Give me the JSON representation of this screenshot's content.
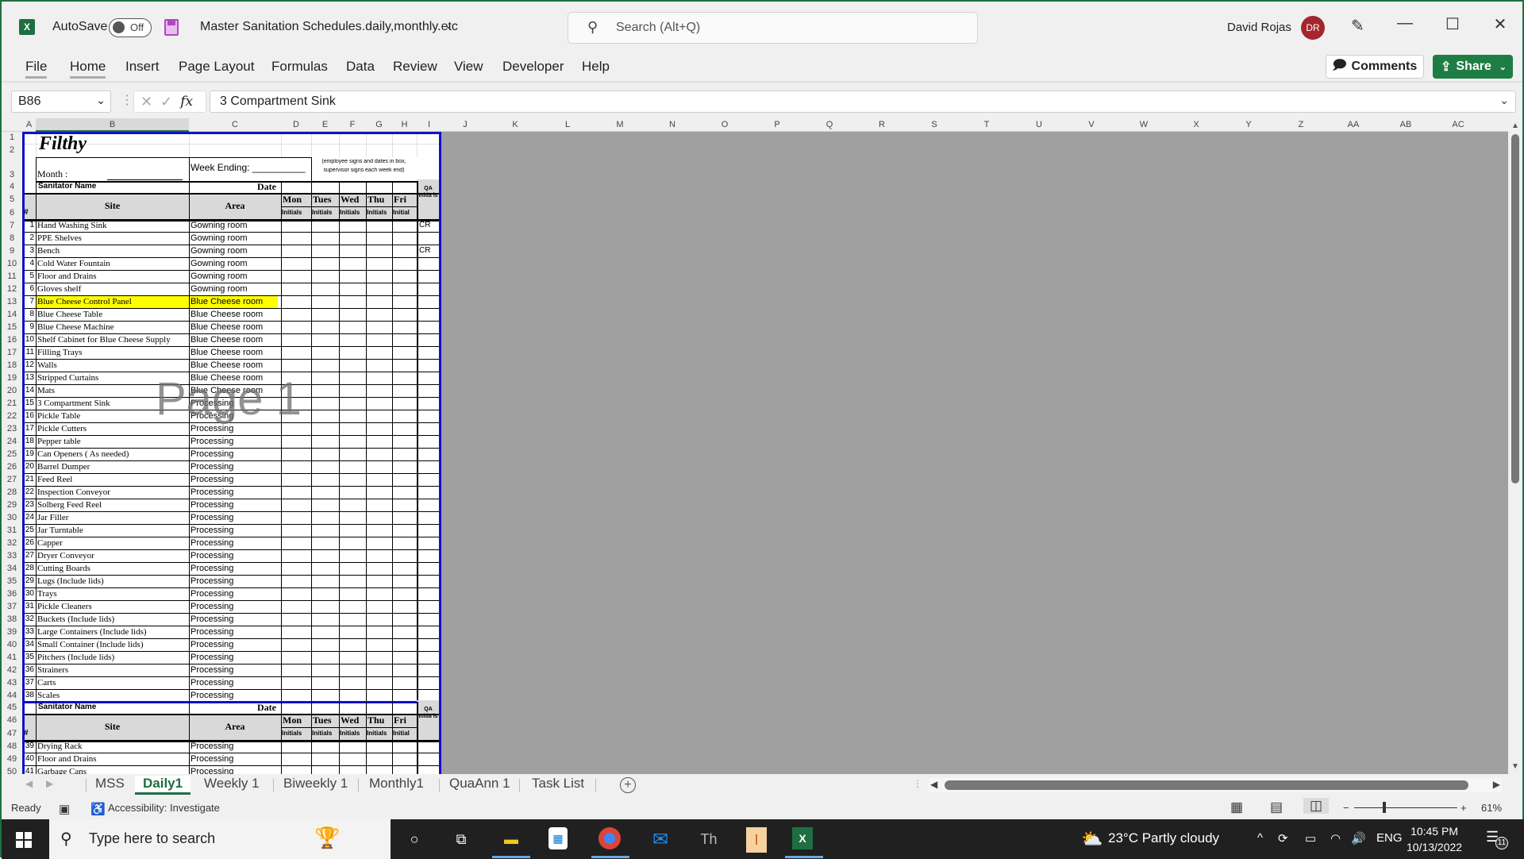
{
  "titlebar": {
    "app_icon": "excel-icon",
    "autosave_label": "AutoSave",
    "autosave_state": "Off",
    "save_icon": "save-icon",
    "document_title": "Master Sanitation Schedules.daily,monthly.etc",
    "search_placeholder": "Search (Alt+Q)",
    "user_name": "David Rojas",
    "user_initials": "DR",
    "avatar_color": "#a4262c",
    "minimize": "—",
    "maximize": "☐",
    "close": "✕"
  },
  "menu": {
    "tabs": [
      "File",
      "Home",
      "Insert",
      "Page Layout",
      "Formulas",
      "Data",
      "Review",
      "View",
      "Developer",
      "Help"
    ],
    "active": "Home",
    "comments_label": "Comments",
    "share_label": "Share",
    "share_color": "#1e7d44"
  },
  "formula_bar": {
    "name_box": "B86",
    "content": "3 Compartment Sink"
  },
  "columns": [
    "A",
    "B",
    "C",
    "D",
    "E",
    "F",
    "G",
    "H",
    "I",
    "J",
    "K",
    "L",
    "M",
    "N",
    "O",
    "P",
    "Q",
    "R",
    "S",
    "T",
    "U",
    "V",
    "W",
    "X",
    "Y",
    "Z",
    "AA",
    "AB",
    "AC"
  ],
  "sheet": {
    "logo_text": "Filthy",
    "month_label": "Month :",
    "week_ending_label": "Week Ending: __________",
    "note_line1": "(employee signs and dates in box,",
    "note_line2": "supervisor signs each week end)",
    "sanitator_label": "Sanitator Name",
    "date_label": "Date",
    "hash_label": "#",
    "site_label": "Site",
    "area_label": "Area",
    "days": [
      "Mon",
      "Tues",
      "Wed",
      "Thu",
      "Fri"
    ],
    "initials_labels": [
      "Initials",
      "Initials",
      "Initials",
      "Initials",
      "Initial"
    ],
    "qa_label": "QA Initia ls",
    "highlight_color": "#ffff00",
    "watermark": "Page 1",
    "rows": [
      {
        "row": 7,
        "num": "1",
        "site": "Hand Washing Sink",
        "area": "Gowning room",
        "qa": "CR"
      },
      {
        "row": 8,
        "num": "2",
        "site": "PPE Shelves",
        "area": "Gowning room",
        "qa": ""
      },
      {
        "row": 9,
        "num": "3",
        "site": "Bench",
        "area": "Gowning room",
        "qa": "CR"
      },
      {
        "row": 10,
        "num": "4",
        "site": "Cold Water Fountain",
        "area": "Gowning room",
        "qa": ""
      },
      {
        "row": 11,
        "num": "5",
        "site": "Floor and Drains",
        "area": "Gowning room",
        "qa": ""
      },
      {
        "row": 12,
        "num": "6",
        "site": "Gloves shelf",
        "area": "Gowning room",
        "qa": ""
      },
      {
        "row": 13,
        "num": "7",
        "site": "Blue Cheese Control Panel",
        "area": "Blue Cheese room",
        "qa": "",
        "highlight": true
      },
      {
        "row": 14,
        "num": "8",
        "site": "Blue Cheese Table",
        "area": "Blue Cheese room",
        "qa": ""
      },
      {
        "row": 15,
        "num": "9",
        "site": "Blue Cheese Machine",
        "area": "Blue Cheese room",
        "qa": ""
      },
      {
        "row": 16,
        "num": "10",
        "site": "Shelf Cabinet for Blue Cheese Supply",
        "area": "Blue Cheese room",
        "qa": ""
      },
      {
        "row": 17,
        "num": "11",
        "site": "Filling Trays",
        "area": "Blue Cheese room",
        "qa": ""
      },
      {
        "row": 18,
        "num": "12",
        "site": "Walls",
        "area": "Blue Cheese room",
        "qa": ""
      },
      {
        "row": 19,
        "num": "13",
        "site": "Stripped Curtains",
        "area": "Blue Cheese room",
        "qa": ""
      },
      {
        "row": 20,
        "num": "14",
        "site": " Mats",
        "area": "Blue Cheese room",
        "qa": ""
      },
      {
        "row": 21,
        "num": "15",
        "site": "3 Compartment Sink",
        "area": "Processing",
        "qa": ""
      },
      {
        "row": 22,
        "num": "16",
        "site": "Pickle Table",
        "area": "Processing",
        "qa": ""
      },
      {
        "row": 23,
        "num": "17",
        "site": "Pickle Cutters",
        "area": "Processing",
        "qa": ""
      },
      {
        "row": 24,
        "num": "18",
        "site": "Pepper table",
        "area": "Processing",
        "qa": ""
      },
      {
        "row": 25,
        "num": "19",
        "site": "Can Openers ( As needed)",
        "area": "Processing",
        "qa": ""
      },
      {
        "row": 26,
        "num": "20",
        "site": "Barrel Dumper",
        "area": "Processing",
        "qa": ""
      },
      {
        "row": 27,
        "num": "21",
        "site": "Feed Reel",
        "area": "Processing",
        "qa": ""
      },
      {
        "row": 28,
        "num": "22",
        "site": "Inspection Conveyor",
        "area": "Processing",
        "qa": ""
      },
      {
        "row": 29,
        "num": "23",
        "site": "Solberg Feed Reel",
        "area": "Processing",
        "qa": ""
      },
      {
        "row": 30,
        "num": "24",
        "site": "Jar Filler",
        "area": "Processing",
        "qa": ""
      },
      {
        "row": 31,
        "num": "25",
        "site": "Jar Turntable",
        "area": "Processing",
        "qa": ""
      },
      {
        "row": 32,
        "num": "26",
        "site": "Capper",
        "area": "Processing",
        "qa": ""
      },
      {
        "row": 33,
        "num": "27",
        "site": "Dryer Conveyor",
        "area": "Processing",
        "qa": ""
      },
      {
        "row": 34,
        "num": "28",
        "site": "Cutting Boards",
        "area": "Processing",
        "qa": ""
      },
      {
        "row": 35,
        "num": "29",
        "site": "Lugs (Include lids)",
        "area": "Processing",
        "qa": ""
      },
      {
        "row": 36,
        "num": "30",
        "site": "Trays",
        "area": "Processing",
        "qa": ""
      },
      {
        "row": 37,
        "num": "31",
        "site": "Pickle Cleaners",
        "area": "Processing",
        "qa": ""
      },
      {
        "row": 38,
        "num": "32",
        "site": "Buckets (Include lids)",
        "area": "Processing",
        "qa": ""
      },
      {
        "row": 39,
        "num": "33",
        "site": "Large Containers (Include lids)",
        "area": "Processing",
        "qa": ""
      },
      {
        "row": 40,
        "num": "34",
        "site": "Small Container (Include lids)",
        "area": "Processing",
        "qa": ""
      },
      {
        "row": 41,
        "num": "35",
        "site": "Pitchers (Include lids)",
        "area": "Processing",
        "qa": ""
      },
      {
        "row": 42,
        "num": "36",
        "site": "Strainers",
        "area": "Processing",
        "qa": ""
      },
      {
        "row": 43,
        "num": "37",
        "site": "Carts",
        "area": "Processing",
        "qa": ""
      },
      {
        "row": 44,
        "num": "38",
        "site": "Scales",
        "area": "Processing",
        "qa": ""
      }
    ],
    "rows2": [
      {
        "row": 48,
        "num": "39",
        "site": "Drying Rack",
        "area": "Processing",
        "qa": ""
      },
      {
        "row": 49,
        "num": "40",
        "site": "Floor and Drains",
        "area": "Processing",
        "qa": ""
      },
      {
        "row": 50,
        "num": "41",
        "site": "Garbage Cans",
        "area": "Processing",
        "qa": ""
      }
    ]
  },
  "sheet_tabs": {
    "tabs": [
      "MSS",
      "Daily1",
      "Weekly 1",
      "Biweekly 1",
      "Monthly1",
      "QuaAnn 1",
      "Task List"
    ],
    "active": "Daily1"
  },
  "statusbar": {
    "ready": "Ready",
    "accessibility": "Accessibility: Investigate",
    "zoom_percent": "61%",
    "zoom_minus": "−",
    "zoom_plus": "+"
  },
  "taskbar": {
    "search_placeholder": "Type here to search",
    "weather": "23°C  Partly cloudy",
    "language": "ENG",
    "time": "10:45 PM",
    "date": "10/13/2022",
    "notifications": "11",
    "apps": [
      "cortana-icon",
      "task-view-icon",
      "file-explorer-icon",
      "microsoft-store-icon",
      "chrome-icon",
      "mail-icon",
      "th-app-icon",
      "app-i-icon",
      "excel-icon"
    ]
  }
}
